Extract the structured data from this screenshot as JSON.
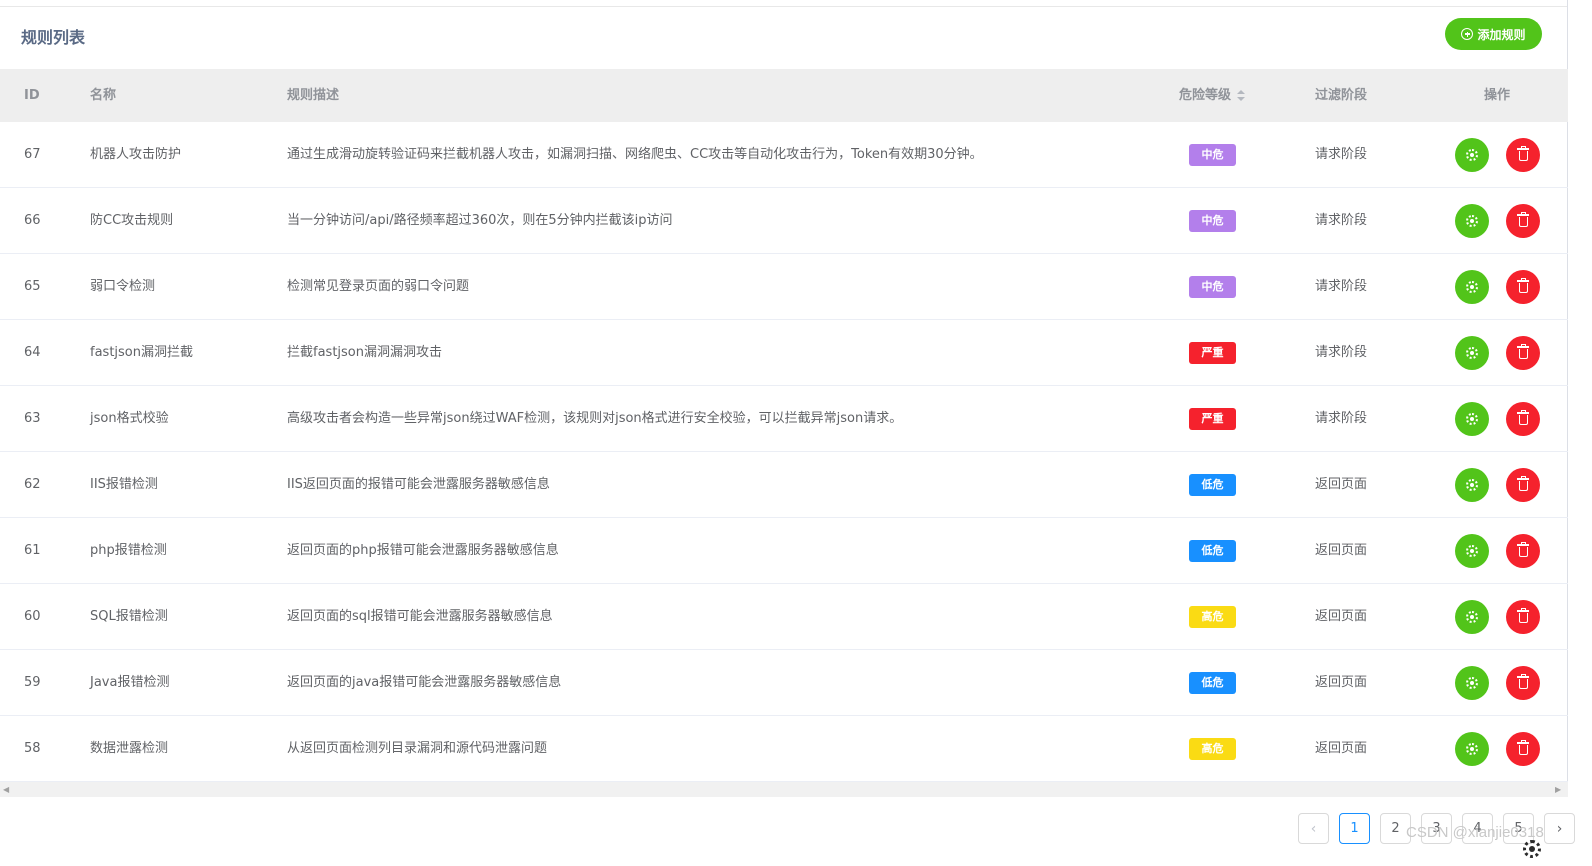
{
  "page": {
    "title": "规则列表",
    "add_button_label": "添加规则"
  },
  "table": {
    "columns": {
      "id": "ID",
      "name": "名称",
      "description": "规则描述",
      "level": "危险等级",
      "phase": "过滤阶段",
      "actions": "操作"
    },
    "rows": [
      {
        "id": "67",
        "name": "机器人攻击防护",
        "description": "通过生成滑动旋转验证码来拦截机器人攻击，如漏洞扫描、网络爬虫、CC攻击等自动化攻击行为，Token有效期30分钟。",
        "level": "中危",
        "level_color": "#b37feb",
        "phase": "请求阶段"
      },
      {
        "id": "66",
        "name": "防CC攻击规则",
        "description": "当一分钟访问/api/路径频率超过360次，则在5分钟内拦截该ip访问",
        "level": "中危",
        "level_color": "#b37feb",
        "phase": "请求阶段"
      },
      {
        "id": "65",
        "name": "弱口令检测",
        "description": "检测常见登录页面的弱口令问题",
        "level": "中危",
        "level_color": "#b37feb",
        "phase": "请求阶段"
      },
      {
        "id": "64",
        "name": "fastjson漏洞拦截",
        "description": "拦截fastjson漏洞漏洞攻击",
        "level": "严重",
        "level_color": "#f5222d",
        "phase": "请求阶段"
      },
      {
        "id": "63",
        "name": "json格式校验",
        "description": "高级攻击者会构造一些异常json绕过WAF检测，该规则对json格式进行安全校验，可以拦截异常json请求。",
        "level": "严重",
        "level_color": "#f5222d",
        "phase": "请求阶段"
      },
      {
        "id": "62",
        "name": "IIS报错检测",
        "description": "IIS返回页面的报错可能会泄露服务器敏感信息",
        "level": "低危",
        "level_color": "#1890ff",
        "phase": "返回页面"
      },
      {
        "id": "61",
        "name": "php报错检测",
        "description": "返回页面的php报错可能会泄露服务器敏感信息",
        "level": "低危",
        "level_color": "#1890ff",
        "phase": "返回页面"
      },
      {
        "id": "60",
        "name": "SQL报错检测",
        "description": "返回页面的sql报错可能会泄露服务器敏感信息",
        "level": "高危",
        "level_color": "#fadb14",
        "phase": "返回页面"
      },
      {
        "id": "59",
        "name": "Java报错检测",
        "description": "返回页面的java报错可能会泄露服务器敏感信息",
        "level": "低危",
        "level_color": "#1890ff",
        "phase": "返回页面"
      },
      {
        "id": "58",
        "name": "数据泄露检测",
        "description": "从返回页面检测列目录漏洞和源代码泄露问题",
        "level": "高危",
        "level_color": "#fadb14",
        "phase": "返回页面"
      }
    ]
  },
  "pagination": {
    "prev_icon": "chevron-left-icon",
    "pages": [
      "1",
      "2",
      "3",
      "4",
      "5"
    ],
    "current": "1",
    "next_icon": "chevron-right-icon"
  },
  "watermark": "CSDN @xianjie0318",
  "colors": {
    "accent_green": "#52c41a",
    "danger_red": "#f5222d",
    "primary_blue": "#1890ff"
  }
}
